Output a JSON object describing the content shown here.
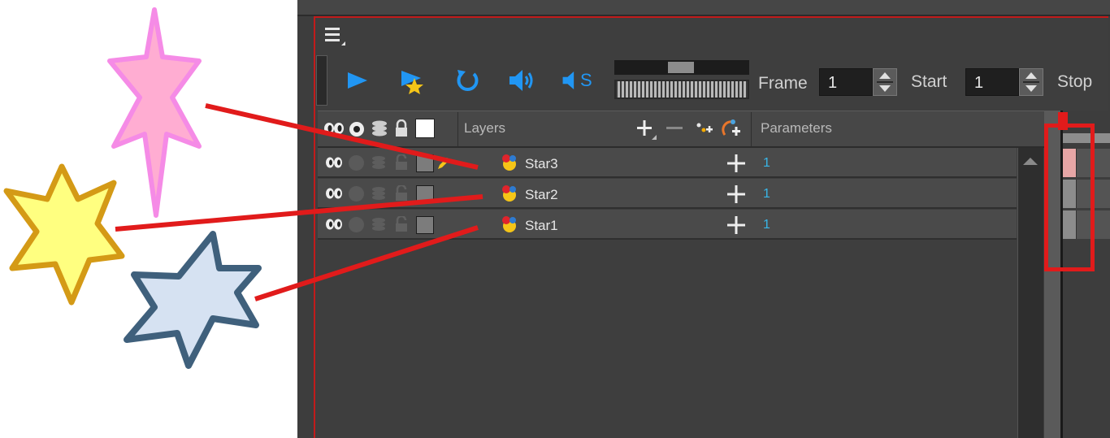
{
  "toolbar": {
    "frame_label": "Frame",
    "frame_value": "1",
    "start_label": "Start",
    "start_value": "1",
    "stop_label": "Stop",
    "sound_scrub_letter": "S",
    "icons": [
      "menu-icon",
      "play-icon",
      "play-selection-icon",
      "loop-icon",
      "sound-icon",
      "sound-scrub-icon"
    ]
  },
  "header": {
    "layers_label": "Layers",
    "parameters_label": "Parameters",
    "icons": [
      "show-all-icon",
      "solo-icon",
      "layers-stack-icon",
      "lock-icon",
      "color-swatch-icon",
      "add-layer-icon",
      "remove-layer-icon",
      "add-peg-icon",
      "add-drawing-icon"
    ]
  },
  "layers": [
    {
      "name": "Star3",
      "param": "1",
      "swatch": "#e88fe0"
    },
    {
      "name": "Star2",
      "param": "1",
      "swatch": "#f0c020"
    },
    {
      "name": "Star1",
      "param": "1",
      "swatch": "#4a6b86"
    }
  ],
  "colors": {
    "accent_red": "#e11b1b",
    "param_blue": "#38b6e8",
    "button_blue": "#2196f3",
    "star_pink": "#ffadd2",
    "star_pink_outline": "#f58be6",
    "star_yellow": "#ffff80",
    "star_yellow_outline": "#d49a16",
    "star_blue": "#d6e2f2",
    "star_blue_outline": "#3f607c"
  }
}
